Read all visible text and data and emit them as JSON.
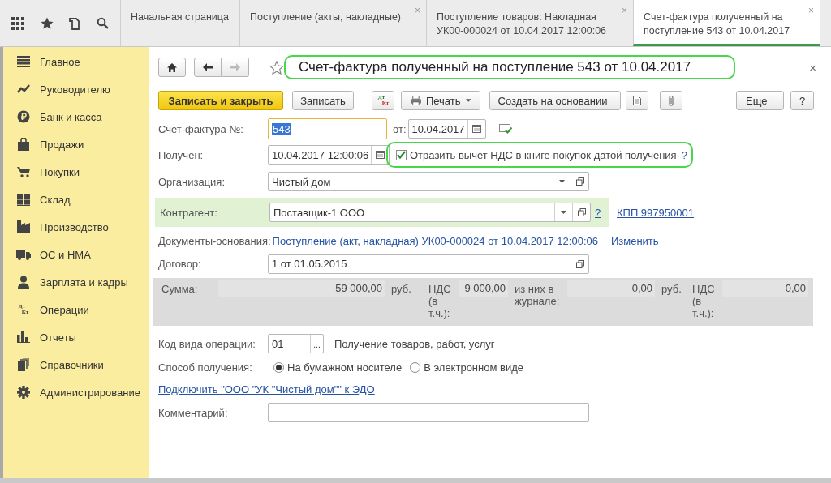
{
  "tabs": [
    {
      "label": "Начальная страница",
      "selected": false
    },
    {
      "label": "Поступление (акты, накладные)",
      "selected": false,
      "close": "×"
    },
    {
      "label": "Поступление товаров: Накладная УК00-000024 от 10.04.2017 12:00:06",
      "selected": false,
      "close": "×"
    },
    {
      "label": "Счет-фактура полученный на поступление 543 от 10.04.2017",
      "selected": true,
      "close": "×"
    }
  ],
  "sidebar": {
    "items": [
      {
        "label": "Главное"
      },
      {
        "label": "Руководителю"
      },
      {
        "label": "Банк и касса"
      },
      {
        "label": "Продажи"
      },
      {
        "label": "Покупки"
      },
      {
        "label": "Склад"
      },
      {
        "label": "Производство"
      },
      {
        "label": "ОС и НМА"
      },
      {
        "label": "Зарплата и кадры"
      },
      {
        "label": "Операции",
        "icon_lines": [
          "Дт",
          "Кт"
        ]
      },
      {
        "label": "Отчеты"
      },
      {
        "label": "Справочники"
      },
      {
        "label": "Администрирование"
      }
    ]
  },
  "form": {
    "title": {
      "text": "Счет-фактура полученный на поступление 543 от 10.04.2017",
      "highlighted": true
    },
    "favorite": false,
    "close": "×",
    "commands": [
      {
        "kind": "primary",
        "label": "Записать и закрыть"
      },
      {
        "kind": "button",
        "label": "Записать"
      },
      {
        "kind": "dtkt",
        "lines": [
          "Дт",
          "Кт"
        ]
      },
      {
        "kind": "print",
        "label": "Печать"
      },
      {
        "kind": "menu",
        "label": "Создать на основании"
      },
      {
        "kind": "doc"
      },
      {
        "kind": "clip"
      },
      {
        "kind": "more",
        "label": "Еще"
      },
      {
        "kind": "button",
        "label": "?"
      }
    ],
    "number": {
      "label": "Счет-фактура №:",
      "value": "543",
      "text_selected": true,
      "date_label": "от:",
      "date": "10.04.2017"
    },
    "received": {
      "label": "Получен:",
      "value": "10.04.2017 12:00:06",
      "checkbox": {
        "label": "Отразить вычет НДС в книге покупок датой получения",
        "checked": true,
        "help": "?",
        "highlighted": true
      }
    },
    "organization": {
      "label": "Организация:",
      "value": "Чистый дом"
    },
    "counterparty": {
      "label": "Контрагент:",
      "value": "Поставщик-1 ООО",
      "help": "?",
      "kpp": "КПП 997950001"
    },
    "base_documents": {
      "label": "Документы-основания:",
      "link": "Поступление (акт, накладная) УК00-000024 от 10.04.2017 12:00:06",
      "change": "Изменить"
    },
    "contract": {
      "label": "Договор:",
      "value": "1 от 01.05.2015"
    },
    "totals": [
      {
        "kind": "label",
        "text": "Сумма:"
      },
      {
        "kind": "value",
        "text": "59 000,00"
      },
      {
        "kind": "label",
        "text": "руб."
      },
      {
        "kind": "label",
        "text": "НДС (в т.ч.):"
      },
      {
        "kind": "value",
        "text": "9 000,00"
      },
      {
        "kind": "label",
        "text": "из них в журнале:"
      },
      {
        "kind": "value",
        "text": "0,00"
      },
      {
        "kind": "label",
        "text": "руб."
      },
      {
        "kind": "label",
        "text": "НДС (в т.ч.):"
      },
      {
        "kind": "value",
        "text": "0,00"
      }
    ],
    "operation_code": {
      "label": "Код вида операции:",
      "value": "01",
      "button": "...",
      "description": "Получение товаров, работ, услуг"
    },
    "receipt_method": {
      "label": "Способ получения:",
      "options": [
        {
          "label": "На бумажном носителе",
          "selected": true
        },
        {
          "label": "В электронном виде",
          "selected": false
        }
      ]
    },
    "edo_link": "Подключить \"ООО \"УК \"Чистый дом\"\" к ЭДО",
    "comment": {
      "label": "Комментарий:"
    }
  }
}
